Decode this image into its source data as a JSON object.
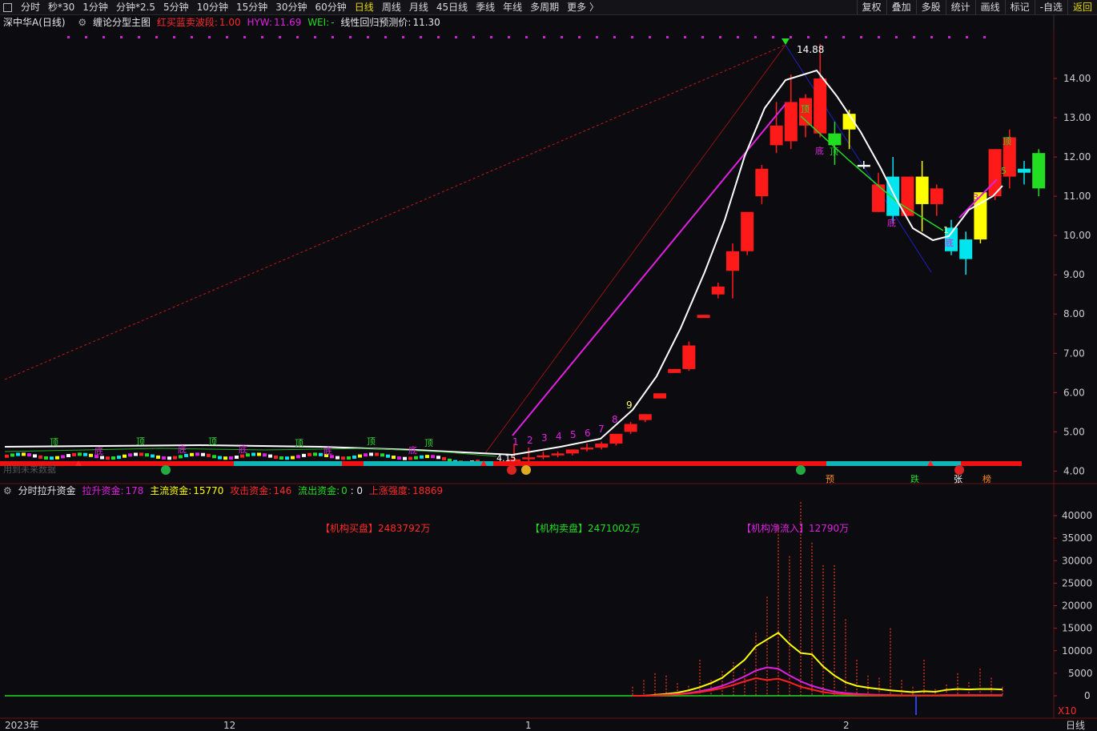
{
  "toolbar": {
    "periods": [
      "分时",
      "秒*30",
      "1分钟",
      "分钟*2.5",
      "5分钟",
      "10分钟",
      "15分钟",
      "30分钟",
      "60分钟",
      "日线",
      "周线",
      "月线",
      "45日线",
      "季线",
      "年线",
      "多周期",
      "更多 〉"
    ],
    "active_period": "日线",
    "right_buttons": [
      "复权",
      "叠加",
      "多股",
      "统计",
      "画线",
      "标记",
      "-自选",
      "返回"
    ]
  },
  "main_header": {
    "stock": "深中华A(日线)",
    "indicator": "缠论分型主图",
    "hmsb_label": "红买蓝卖波段:",
    "hmsb_value": "1.00",
    "hyw_label": "HYW:",
    "hyw_value": "11.69",
    "wei_label": "WEI:",
    "wei_value": "-",
    "forecast_label": "线性回归预测价:",
    "forecast_value": "11.30"
  },
  "sub_header": {
    "indicator": "分时拉升资金",
    "lift_label": "拉升资金:",
    "lift_value": "178",
    "main_label": "主流资金:",
    "main_value": "15770",
    "attack_label": "攻击资金:",
    "attack_value": "146",
    "outflow_label": "流出资金:",
    "outflow_value": "0",
    "sep": ": 0",
    "strength_label": "上涨强度:",
    "strength_value": "18869"
  },
  "annotations": {
    "inst_buy": "【机构买盘】2483792万",
    "inst_sell": "【机构卖盘】2471002万",
    "inst_net": "【机构净流入】12790万",
    "high_label": "14.88",
    "low_label": "4.15",
    "x10": "X10",
    "cut_label": "用到未来数据",
    "bottom_signals": [
      "预",
      "跌",
      "张",
      "榜"
    ]
  },
  "x_axis": {
    "labels": [
      "2023年",
      "12",
      "1",
      "2"
    ],
    "right_label": "日线"
  },
  "colors": {
    "up": "#ff1a1a",
    "down": "#00e5ee",
    "yellow": "#ffff00",
    "magenta": "#e020e0",
    "green": "#22dd22",
    "white": "#ffffff"
  },
  "chart_data": [
    {
      "type": "candlestick",
      "title": "",
      "ylim": [
        3.6,
        15.0
      ],
      "y_ticks": [
        4.0,
        5.0,
        6.0,
        7.0,
        8.0,
        9.0,
        10.0,
        11.0,
        12.0,
        13.0,
        14.0
      ],
      "candles_ohlc": [
        [
          4.25,
          4.7,
          4.15,
          4.3
        ],
        [
          4.3,
          4.6,
          4.2,
          4.35
        ],
        [
          4.35,
          4.5,
          4.3,
          4.4
        ],
        [
          4.4,
          4.5,
          4.35,
          4.45
        ],
        [
          4.45,
          4.55,
          4.4,
          4.55
        ],
        [
          4.55,
          4.7,
          4.5,
          4.6
        ],
        [
          4.6,
          4.75,
          4.55,
          4.7
        ],
        [
          4.7,
          4.95,
          4.65,
          4.95
        ],
        [
          5.0,
          5.25,
          4.95,
          5.2
        ],
        [
          5.3,
          5.45,
          5.25,
          5.45
        ],
        [
          5.85,
          5.98,
          5.85,
          5.98
        ],
        [
          6.5,
          6.6,
          6.5,
          6.6
        ],
        [
          6.6,
          7.3,
          6.55,
          7.2
        ],
        [
          7.9,
          7.98,
          7.9,
          7.98
        ],
        [
          8.5,
          8.8,
          8.4,
          8.7
        ],
        [
          9.1,
          9.8,
          8.4,
          9.6
        ],
        [
          9.6,
          10.6,
          9.5,
          10.6
        ],
        [
          11.0,
          11.8,
          10.8,
          11.7
        ],
        [
          12.3,
          13.4,
          12.1,
          12.8
        ],
        [
          12.4,
          14.1,
          12.2,
          13.4
        ],
        [
          12.8,
          13.6,
          12.5,
          13.5
        ],
        [
          12.6,
          14.88,
          12.5,
          14.0
        ],
        [
          12.6,
          12.9,
          11.8,
          12.3
        ],
        [
          12.7,
          13.2,
          12.2,
          13.1
        ],
        [
          11.75,
          11.9,
          11.7,
          11.8
        ],
        [
          10.6,
          11.6,
          10.6,
          11.3
        ],
        [
          11.5,
          12.0,
          10.3,
          10.5
        ],
        [
          10.5,
          11.5,
          10.5,
          11.5
        ],
        [
          10.8,
          11.9,
          10.1,
          11.5
        ],
        [
          10.8,
          11.3,
          10.5,
          11.2
        ],
        [
          10.2,
          10.4,
          9.5,
          9.6
        ],
        [
          9.9,
          10.1,
          9.0,
          9.4
        ],
        [
          9.9,
          11.1,
          9.8,
          11.1
        ],
        [
          11.0,
          12.2,
          10.9,
          12.2
        ],
        [
          11.5,
          12.7,
          11.2,
          12.5
        ],
        [
          11.7,
          11.9,
          11.3,
          11.6
        ],
        [
          12.1,
          12.2,
          11.0,
          11.2
        ]
      ],
      "wave_labels": [
        "1",
        "2",
        "3",
        "4",
        "5",
        "6",
        "7",
        "8",
        "9"
      ],
      "fractal_top": "顶",
      "fractal_bottom": "底"
    },
    {
      "type": "bar",
      "title": "",
      "ylim": [
        -5000,
        45000
      ],
      "y_ticks": [
        0,
        5000,
        10000,
        15000,
        20000,
        25000,
        30000,
        35000,
        40000
      ],
      "series": [
        {
          "name": "",
          "values": [
            2000,
            3500,
            5000,
            4500,
            2800,
            2200,
            8000,
            3500,
            5500,
            7500,
            6000,
            14000,
            22000,
            38000,
            31000,
            43000,
            34000,
            29000,
            29000,
            17000,
            8000,
            4500,
            4000,
            15000,
            3500,
            2000,
            8000,
            1500,
            2500,
            5000,
            3000,
            6000,
            4000,
            2000
          ]
        }
      ],
      "lines": {
        "main_capital_yellow": [
          0,
          0,
          200,
          400,
          700,
          1200,
          1900,
          2800,
          4000,
          6000,
          8000,
          11000,
          12500,
          14000,
          11500,
          9500,
          9200,
          6500,
          4500,
          3000,
          2200,
          1800,
          1500,
          1200,
          1000,
          800,
          1000,
          900,
          1300,
          1500,
          1400,
          1500,
          1500,
          1400
        ],
        "lift_capital_magenta": [
          0,
          0,
          100,
          200,
          400,
          600,
          1000,
          1500,
          2200,
          3200,
          4300,
          5600,
          6300,
          6000,
          4500,
          3200,
          2200,
          1500,
          900,
          600,
          400,
          300,
          200,
          150,
          100,
          100,
          100,
          100,
          150,
          150,
          150,
          150,
          150,
          150
        ],
        "attack_capital_red": [
          0,
          0,
          80,
          150,
          300,
          500,
          800,
          1200,
          1700,
          2400,
          3200,
          3900,
          3500,
          3800,
          3000,
          2000,
          1400,
          800,
          500,
          300,
          200,
          150,
          100,
          100,
          100,
          100,
          100,
          100,
          100,
          100,
          100,
          100,
          100,
          100
        ]
      }
    }
  ]
}
